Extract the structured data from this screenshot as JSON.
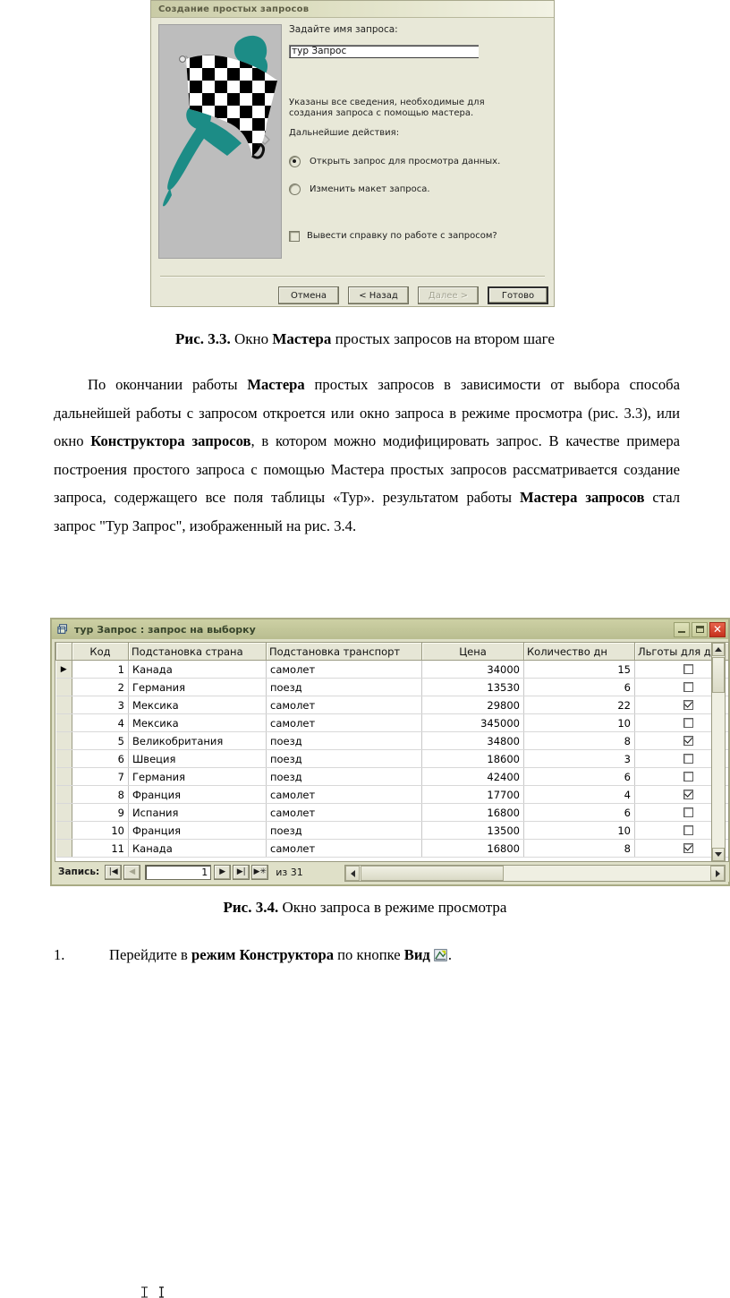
{
  "wizard": {
    "title": "Создание простых запросов",
    "name_label": "Задайте имя запроса:",
    "name_value": "тур Запрос",
    "info_text": "Указаны все сведения, необходимые для создания запроса с помощью мастера.",
    "next_action_label": "Дальнейшие действия:",
    "radio_open": "Открыть запрос для просмотра данных.",
    "radio_modify": "Изменить макет запроса.",
    "checkbox_help": "Вывести справку по работе с запросом?",
    "buttons": {
      "cancel": "Отмена",
      "back": "< Назад",
      "next": "Далее >",
      "finish": "Готово"
    }
  },
  "figure_33_caption": {
    "number": "Рис. 3.3.",
    "rest_1": " Окно ",
    "bold_1": "Мастера",
    "rest_2": " простых запросов на втором шаге"
  },
  "body_paragraph": {
    "p1": "По окончании работы ",
    "b1": "Мастера",
    "p2": " простых запросов в зависимости от выбора способа дальнейшей работы с запросом откроется или окно запроса в режиме просмотра (рис. 3.3), или окно ",
    "b2": "Конструктора запросов",
    "p3": ", в котором можно модифицировать запрос. В качестве примера построения простого запроса с помощью Мастера простых запросов рассматривается создание запроса, содержащего все поля таблицы «Тур». результатом работы ",
    "b3": "Мастера запросов",
    "p4": " стал запрос \"Тур Запрос\", изображенный на рис. 3.4."
  },
  "access_window": {
    "title": "тур Запрос : запрос на выборку",
    "columns": [
      "Код",
      "Подстановка страна",
      "Подстановка транспорт",
      "Цена",
      "Количество дн",
      "Льготы для де"
    ],
    "rows": [
      {
        "kod": "1",
        "strana": "Канада",
        "transport": "самолет",
        "cena": "34000",
        "dney": "15",
        "lgoty": false
      },
      {
        "kod": "2",
        "strana": "Германия",
        "transport": "поезд",
        "cena": "13530",
        "dney": "6",
        "lgoty": false
      },
      {
        "kod": "3",
        "strana": "Мексика",
        "transport": "самолет",
        "cena": "29800",
        "dney": "22",
        "lgoty": true
      },
      {
        "kod": "4",
        "strana": "Мексика",
        "transport": "самолет",
        "cena": "345000",
        "dney": "10",
        "lgoty": false
      },
      {
        "kod": "5",
        "strana": "Великобритания",
        "transport": "поезд",
        "cena": "34800",
        "dney": "8",
        "lgoty": true
      },
      {
        "kod": "6",
        "strana": "Швеция",
        "transport": "поезд",
        "cena": "18600",
        "dney": "3",
        "lgoty": false
      },
      {
        "kod": "7",
        "strana": "Германия",
        "transport": "поезд",
        "cena": "42400",
        "dney": "6",
        "lgoty": false
      },
      {
        "kod": "8",
        "strana": "Франция",
        "transport": "самолет",
        "cena": "17700",
        "dney": "4",
        "lgoty": true
      },
      {
        "kod": "9",
        "strana": "Испания",
        "transport": "самолет",
        "cena": "16800",
        "dney": "6",
        "lgoty": false
      },
      {
        "kod": "10",
        "strana": "Франция",
        "transport": "поезд",
        "cena": "13500",
        "dney": "10",
        "lgoty": false
      },
      {
        "kod": "11",
        "strana": "Канада",
        "transport": "самолет",
        "cena": "16800",
        "dney": "8",
        "lgoty": true
      }
    ],
    "status": {
      "record_label": "Запись:",
      "record_value": "1",
      "total_text": "из 31",
      "first_glyph": "|◀",
      "prev_glyph": "◀",
      "next_glyph": "▶",
      "last_glyph": "▶|",
      "new_glyph": "▶✳"
    }
  },
  "figure_34_caption": {
    "number": "Рис. 3.4.",
    "rest": " Окно запроса в режиме просмотра"
  },
  "numbered_item": {
    "marker": "1.",
    "t1": "Перейдите в ",
    "b1": "режим Конструктора",
    "t2": " по кнопке  ",
    "b2": "Вид",
    "t3": "."
  },
  "colors": {
    "wizard_face": "#e8e8d8",
    "access_chrome": "#dfe0c8",
    "access_title": "#c3c79a",
    "close_red": "#c5301c",
    "flag_teal": "#1c8c86"
  }
}
